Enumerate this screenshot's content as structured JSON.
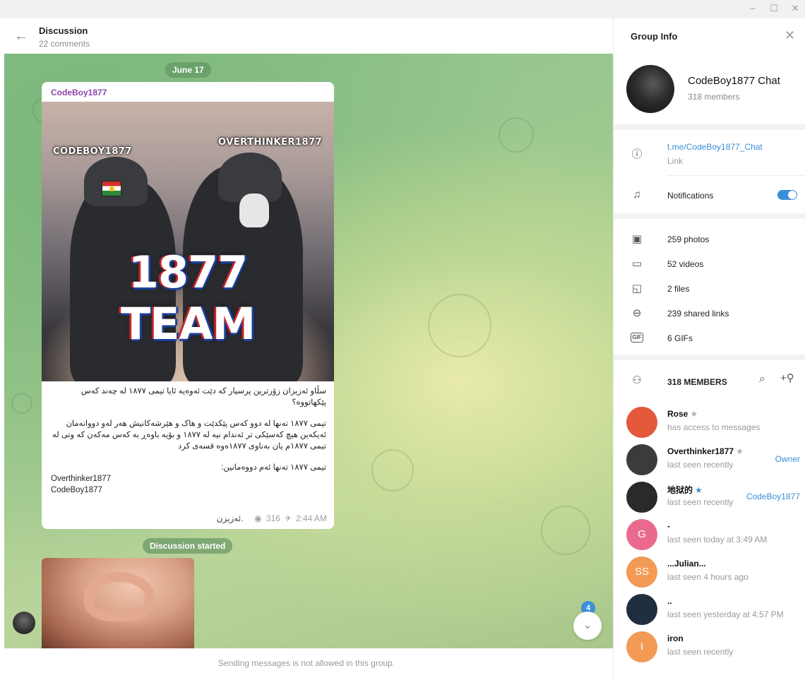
{
  "window": {
    "minimize": "–",
    "maximize": "☐",
    "close": "✕"
  },
  "chat": {
    "title": "Discussion",
    "subtitle": "22 comments",
    "date_pill": "June 17",
    "post": {
      "author": "CodeBoy1877",
      "image_labels": {
        "left": "CODEBOY1877",
        "right": "OVERTHINKER1877",
        "team": "1877 TEAM"
      },
      "lines": [
        {
          "text": "سڵاو ئەزیزان زۆرترین پرسیار کە دێت ئەوەیە ئایا تیمی ١٨٧٧ لە چەند کەس پێکهاتووە؟",
          "dir": "rtl"
        },
        {
          "text": "",
          "dir": "gap"
        },
        {
          "text": "تیمی ١٨٧٧ تەنها لە دوو کەس پێکدێت و هاک و هێرشەکانیش هەر لەو دووانەمان ئەیکەین هیچ کەسێکی تر ئەندام نیە لە ١٨٧٧ و بۆیە باوەڕ بە کەس مەکەن کە وتی لە تیمی ١٨٧٧م یان بەناوی ١٨٧٧ەوە قسەی کرد",
          "dir": "rtl"
        },
        {
          "text": "",
          "dir": "gap"
        },
        {
          "text": "تیمی ١٨٧٧ تەنها ئەم دووەمانین:",
          "dir": "rtl"
        },
        {
          "text": "Overthinker1877",
          "dir": "ltr"
        },
        {
          "text": "CodeBoy1877",
          "dir": "ltr"
        }
      ],
      "signature": "ئەزیزن.",
      "views": "316",
      "time": "2:44 AM"
    },
    "discussion_pill": "Discussion started",
    "unread_count": "4",
    "footer": "Sending messages is not allowed in this group."
  },
  "panel": {
    "title": "Group Info",
    "group_name": "CodeBoy1877 Chat",
    "group_members": "318 members",
    "link": "t.me/CodeBoy1877_Chat",
    "link_label": "Link",
    "notifications": "Notifications",
    "notifications_on": true,
    "media": [
      {
        "icon": "photo-icon",
        "glyph": "▣",
        "label": "259 photos"
      },
      {
        "icon": "video-icon",
        "glyph": "▭",
        "label": "52 videos"
      },
      {
        "icon": "file-icon",
        "glyph": "◱",
        "label": "2 files"
      },
      {
        "icon": "link-icon",
        "glyph": "⊖",
        "label": "239 shared links"
      },
      {
        "icon": "gif-icon",
        "glyph": "GIF",
        "label": "6 GIFs"
      }
    ],
    "members_title": "318 MEMBERS",
    "members": [
      {
        "name": "Rose",
        "star": "★",
        "star_color": "gray",
        "status": "has access to messages",
        "role": "",
        "avatar_text": "",
        "avatar_color": "#e3573b"
      },
      {
        "name": "Overthinker1877",
        "star": "★",
        "star_color": "gray",
        "status": "last seen recently",
        "role": "Owner",
        "avatar_text": "",
        "avatar_color": "#3b3b3b"
      },
      {
        "name": "地狱的",
        "star": "★",
        "star_color": "blue",
        "status": "last seen recently",
        "role": "CodeBoy1877",
        "avatar_text": "",
        "avatar_color": "#2a2a2a"
      },
      {
        "name": "-",
        "star": "",
        "star_color": "gray",
        "status": "last seen today at 3:49 AM",
        "role": "",
        "avatar_text": "G",
        "avatar_color": "#ea6a8e"
      },
      {
        "name": "...Julian...",
        "star": "",
        "star_color": "gray",
        "status": "last seen 4 hours ago",
        "role": "",
        "avatar_text": "SS",
        "avatar_color": "#f39a55"
      },
      {
        "name": "..",
        "star": "",
        "star_color": "gray",
        "status": "last seen yesterday at 4:57 PM",
        "role": "",
        "avatar_text": "",
        "avatar_color": "#1f2f3f"
      },
      {
        "name": "iron",
        "star": "",
        "star_color": "gray",
        "status": "last seen recently",
        "role": "",
        "avatar_text": "I",
        "avatar_color": "#f39a55"
      }
    ],
    "colors": {
      "accent": "#3a8fd9",
      "author": "#8e44ad"
    }
  }
}
